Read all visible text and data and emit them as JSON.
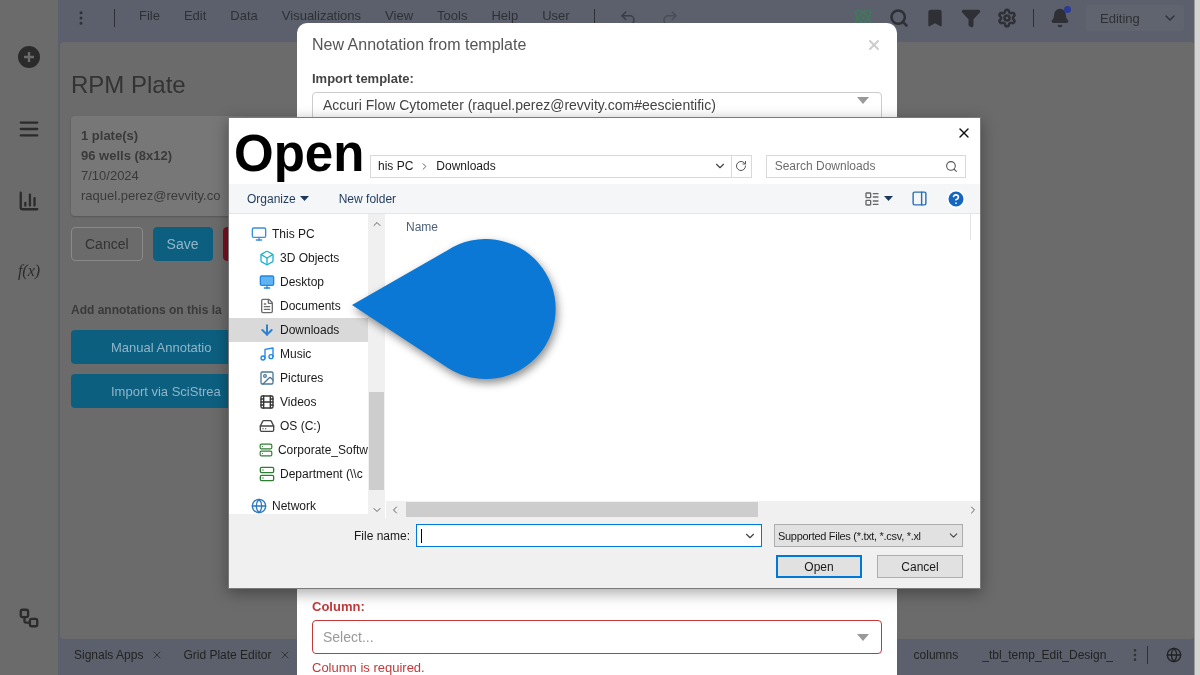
{
  "app": {
    "menu": [
      "File",
      "Edit",
      "Data",
      "Visualizations",
      "View",
      "Tools",
      "Help",
      "User"
    ],
    "mode": "Editing",
    "function_label": "f(x)",
    "page_title": "RPM Plate",
    "plate_info": [
      {
        "text": "1 plate(s)",
        "bold": true
      },
      {
        "text": "96 wells (8x12)",
        "bold": true
      },
      {
        "text": "7/10/2024",
        "bold": false
      },
      {
        "text": "raquel.perez@revvity.co",
        "bold": false
      }
    ],
    "actions": [
      {
        "label": "Cancel",
        "kind": "outline"
      },
      {
        "label": "Save",
        "kind": "primary"
      },
      {
        "kind": "danger"
      }
    ],
    "annotations_prompt": "Add annotations on this la",
    "annotation_buttons": [
      "Manual Annotatio",
      "Import via SciStrea"
    ],
    "bottom_tabs_left": [
      {
        "label": "Signals Apps",
        "closable": true
      },
      {
        "label": "Grid Plate Editor",
        "closable": true
      }
    ],
    "bottom_tabs_right": [
      {
        "label": "columns",
        "closable": false
      },
      {
        "label": "_tbl_temp_Edit_Design_",
        "closable": false
      }
    ]
  },
  "template_dialog": {
    "title": "New Annotation from template",
    "template_label": "Import template:",
    "template_value": "Accuri Flow Cytometer (raquel.perez@revvity.com#eescientific)",
    "column_label": "Column:",
    "column_placeholder": "Select...",
    "column_error": "Column is required."
  },
  "open_dialog": {
    "heading": "Open",
    "path": [
      "his PC",
      "Downloads"
    ],
    "search_placeholder": "Search Downloads",
    "toolbar": [
      "Organize",
      "New folder"
    ],
    "nav": [
      {
        "label": "This PC",
        "kind": "pc",
        "selected": false,
        "children": [
          {
            "label": "3D Objects",
            "kind": "objects",
            "selected": false
          },
          {
            "label": "Desktop",
            "kind": "desktop",
            "selected": false
          },
          {
            "label": "Documents",
            "kind": "documents",
            "selected": false
          },
          {
            "label": "Downloads",
            "kind": "downloads",
            "selected": true
          },
          {
            "label": "Music",
            "kind": "music",
            "selected": false
          },
          {
            "label": "Pictures",
            "kind": "pictures",
            "selected": false
          },
          {
            "label": "Videos",
            "kind": "videos",
            "selected": false
          },
          {
            "label": "OS (C:)",
            "kind": "drive",
            "selected": false
          },
          {
            "label": "Corporate_Softw",
            "kind": "netdrive",
            "selected": false
          },
          {
            "label": "Department (\\\\c",
            "kind": "netdrive",
            "selected": false
          }
        ]
      },
      {
        "label": "Network",
        "kind": "network",
        "selected": false
      }
    ],
    "column": "Name",
    "file_name_label": "File name:",
    "file_type": "Supported Files (*.txt, *.csv, *.xl",
    "buttons": [
      "Open",
      "Cancel"
    ]
  }
}
